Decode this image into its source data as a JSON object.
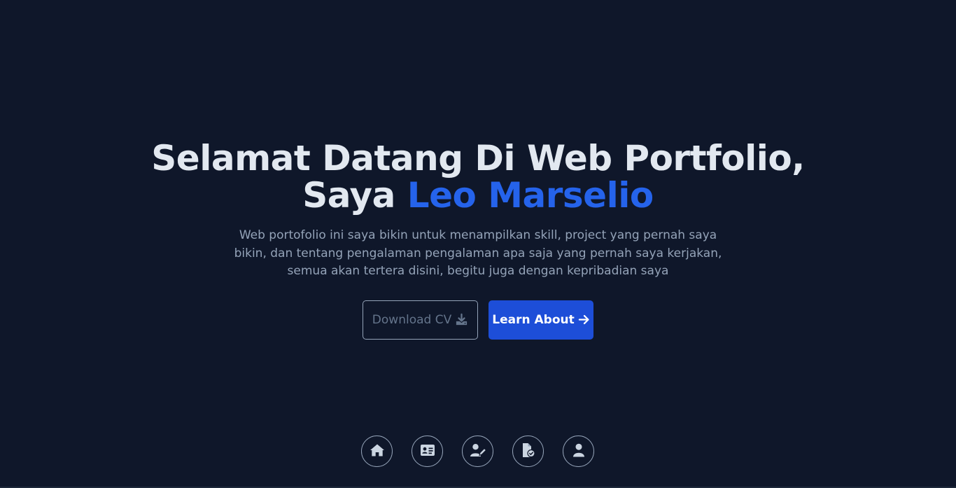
{
  "hero": {
    "headline_line1": "Selamat Datang Di Web Portfolio,",
    "headline_prefix": "Saya",
    "headline_name": "Leo Marselio",
    "intro": "Web portofolio ini saya bikin untuk menampilkan skill, project yang pernah saya bikin, dan tentang pengalaman pengalaman apa saja yang pernah saya kerjakan, semua akan tertera disini, begitu juga dengan kepribadian saya"
  },
  "actions": {
    "download_label": "Download CV",
    "learn_label": "Learn About"
  },
  "dock": {
    "items": [
      {
        "icon": "home-icon"
      },
      {
        "icon": "id-card-icon"
      },
      {
        "icon": "user-pen-icon"
      },
      {
        "icon": "file-check-icon"
      },
      {
        "icon": "user-icon"
      }
    ]
  },
  "colors": {
    "background": "#0f172a",
    "heading": "#e2e8f0",
    "accent": "#2563eb",
    "body_text": "#94a3b8",
    "primary_button": "#1d4ed8"
  }
}
